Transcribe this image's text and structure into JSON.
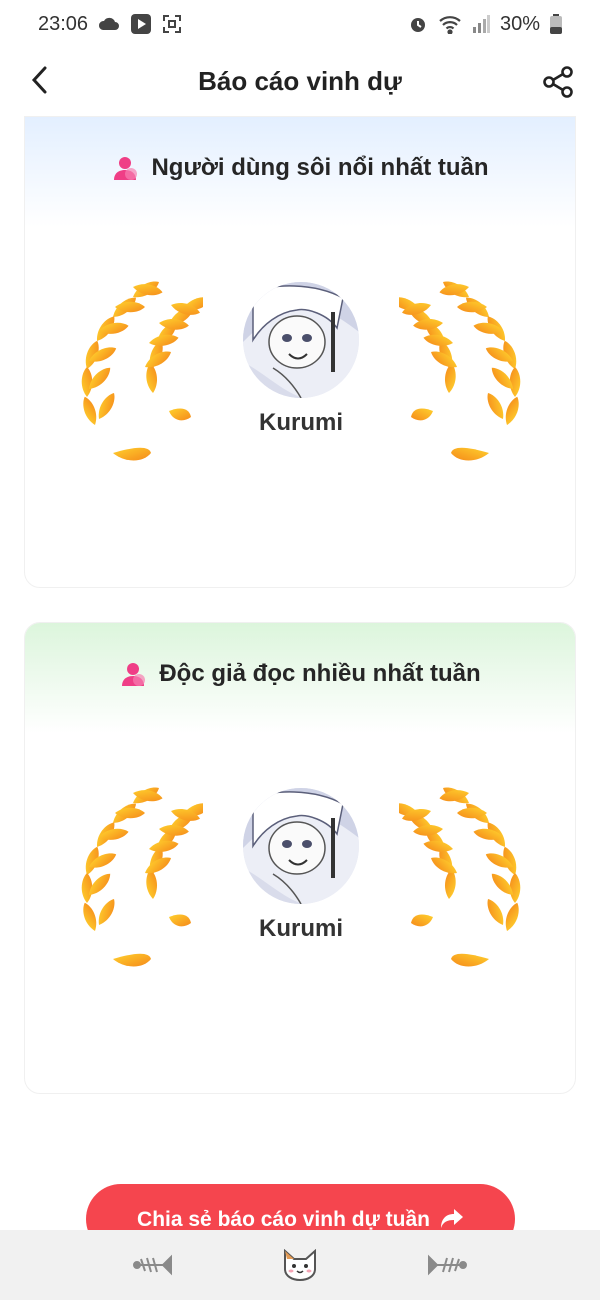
{
  "status_bar": {
    "time": "23:06",
    "battery": "30%",
    "icons": [
      "cloud-icon",
      "media-icon",
      "screenshot-icon",
      "alarm-icon",
      "wifi-icon",
      "signal-icon",
      "battery-icon"
    ]
  },
  "header": {
    "title": "Báo cáo vinh dự",
    "back_icon": "chevron-left-icon",
    "share_icon": "share-icon"
  },
  "cards": [
    {
      "title": "Người dùng sôi nổi nhất tuần",
      "winner_name": "Kurumi",
      "accent": "#e3efff"
    },
    {
      "title": "Độc giả đọc nhiều nhất tuần",
      "winner_name": "Kurumi",
      "accent": "#dcf5dc"
    }
  ],
  "cta": {
    "label": "Chia sẻ báo cáo vinh dự tuần",
    "color": "#f5454e"
  },
  "bottom_nav": {
    "tabs": [
      "fish-bone-icon",
      "cat-face-icon",
      "fish-bone-icon"
    ]
  },
  "colors": {
    "laurel_light": "#ffd22e",
    "laurel_dark": "#f5891a",
    "user_icon": "#ef3e86"
  }
}
